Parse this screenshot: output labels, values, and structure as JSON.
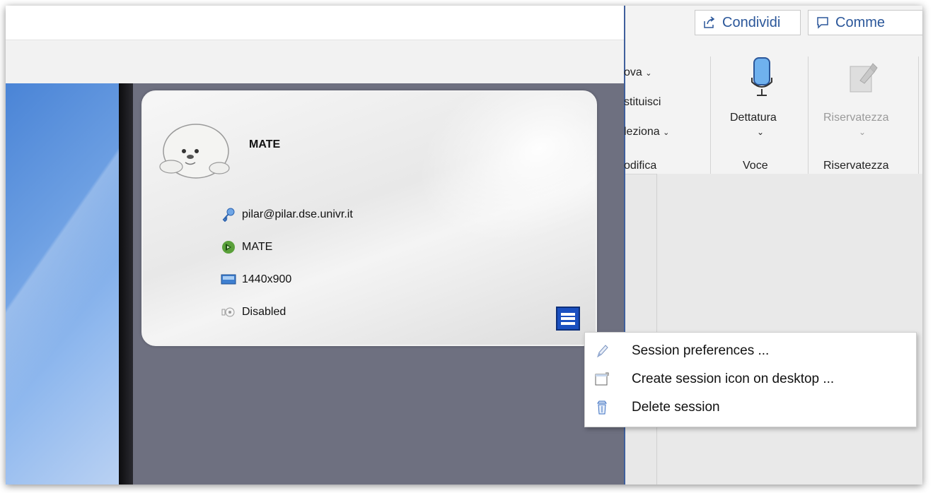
{
  "session": {
    "name": "MATE",
    "host": "pilar@pilar.dse.univr.it",
    "desktop": "MATE",
    "resolution": "1440x900",
    "sound": "Disabled"
  },
  "word": {
    "share_label": "Condividi",
    "comments_label": "Comme",
    "editing": {
      "find": "ova",
      "replace": "stituisci",
      "select": "leziona",
      "group": "odifica"
    },
    "dictation_label": "Dettatura",
    "voice_group": "Voce",
    "privacy_label": "Riservatezza",
    "privacy_group": "Riservatezza"
  },
  "context_menu": {
    "items": [
      {
        "label": "Session preferences ...",
        "icon": "pencil-icon"
      },
      {
        "label": "Create session icon on desktop ...",
        "icon": "desktop-shortcut-icon"
      },
      {
        "label": "Delete session",
        "icon": "trash-icon"
      }
    ]
  },
  "colors": {
    "accent": "#2b579a",
    "menu_button": "#1a4fc0",
    "session_bg": "#6e7080"
  }
}
